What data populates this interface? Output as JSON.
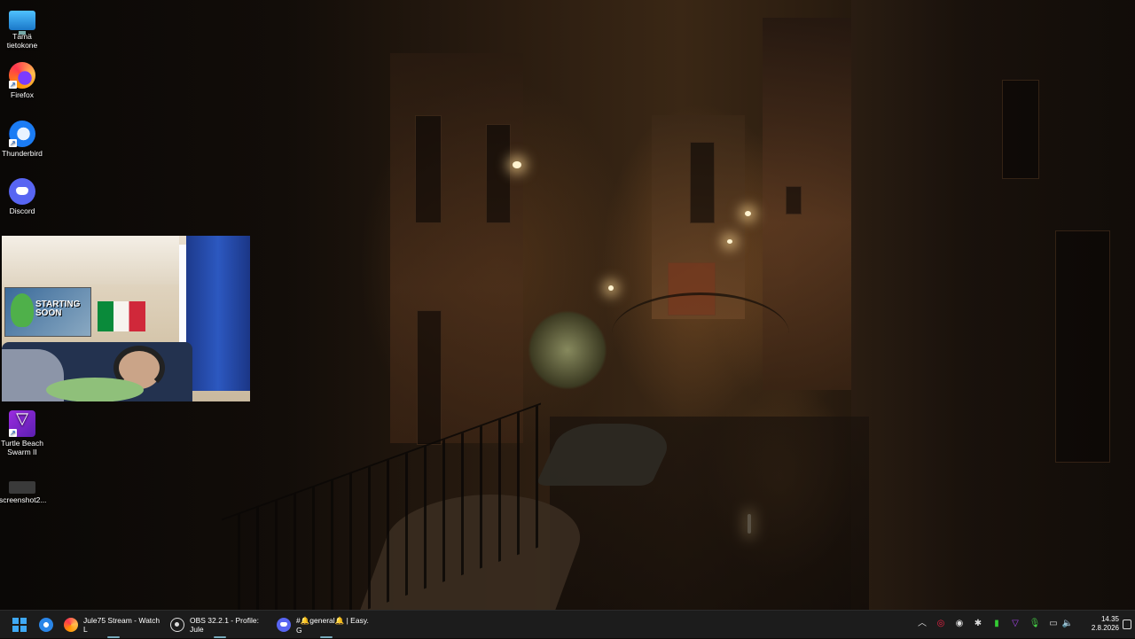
{
  "desktop": {
    "icons": [
      {
        "label": "Tämä tietokone",
        "icon": "this-pc-icon"
      },
      {
        "label": "Firefox",
        "icon": "firefox-icon"
      },
      {
        "label": "Thunderbird",
        "icon": "thunderbird-icon"
      },
      {
        "label": "Discord",
        "icon": "discord-icon"
      },
      {
        "label": "Turtle Beach Swarm II",
        "icon": "turtle-beach-icon"
      },
      {
        "label": "screenshot2...",
        "icon": "screenshot-file-icon"
      }
    ],
    "webcam_overlay": {
      "poster_text": "STARTING SOON"
    }
  },
  "taskbar": {
    "apps": [
      {
        "label": "Jule75 Stream - Watch L",
        "icon": "firefox-icon"
      },
      {
        "label": "OBS 32.2.1 - Profile: Jule",
        "icon": "obs-icon"
      },
      {
        "label": "#🔔general🔔 | Easy. G",
        "icon": "discord-icon"
      }
    ],
    "tray": {
      "icons": [
        "chevron-up-icon",
        "steelseries-icon",
        "discord-icon",
        "bluetooth-icon",
        "battery-app-icon",
        "turtle-beach-icon",
        "microphone-icon",
        "network-icon",
        "speaker-icon"
      ],
      "time": "14.35",
      "date": "2.8.2026"
    }
  },
  "colors": {
    "taskbar_bg": "#1c1c1c",
    "accent": "#3fa9f5"
  }
}
